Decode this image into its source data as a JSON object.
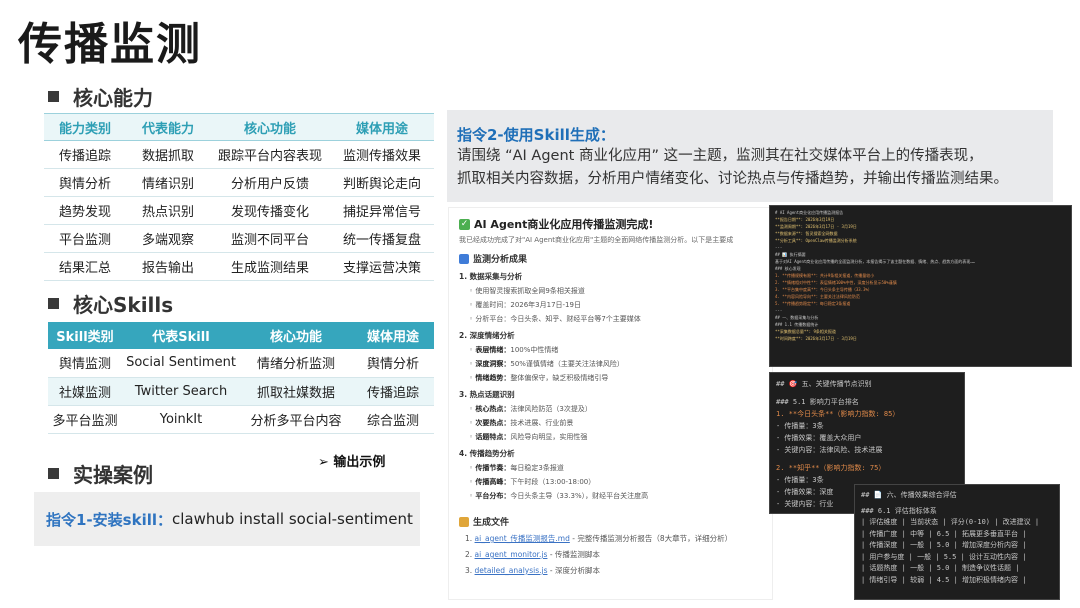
{
  "title": "传播监测",
  "section1": "核心能力",
  "section2": "核心Skills",
  "section3": "实操案例",
  "table1": {
    "headers": [
      "能力类别",
      "代表能力",
      "核心功能",
      "媒体用途"
    ],
    "rows": [
      [
        "传播追踪",
        "数据抓取",
        "跟踪平台内容表现",
        "监测传播效果"
      ],
      [
        "舆情分析",
        "情绪识别",
        "分析用户反馈",
        "判断舆论走向"
      ],
      [
        "趋势发现",
        "热点识别",
        "发现传播变化",
        "捕捉异常信号"
      ],
      [
        "平台监测",
        "多端观察",
        "监测不同平台",
        "统一传播复盘"
      ],
      [
        "结果汇总",
        "报告输出",
        "生成监测结果",
        "支撑运营决策"
      ]
    ]
  },
  "table2": {
    "headers": [
      "Skill类别",
      "代表Skill",
      "核心功能",
      "媒体用途"
    ],
    "rows": [
      [
        "舆情监测",
        "Social Sentiment",
        "情绪分析监测",
        "舆情分析"
      ],
      [
        "社媒监测",
        "Twitter Search",
        "抓取社媒数据",
        "传播追踪"
      ],
      [
        "多平台监测",
        "YoinkIt",
        "分析多平台内容",
        "综合监测"
      ]
    ]
  },
  "case1": {
    "label": "指令1-安装skill：",
    "command": "clawhub install social-sentiment"
  },
  "example_label": "➢  输出示例",
  "instruction2": {
    "heading": "指令2-使用Skill生成：",
    "line1": "请围绕 “AI Agent 商业化应用” 这一主题，监测其在社交媒体平台上的传播表现，",
    "line2": "抓取相关内容数据，分析用户情绪变化、讨论热点与传播趋势，并输出传播监测结果。"
  },
  "report": {
    "title": "AI Agent商业化应用传播监测完成!",
    "subtitle": "我已经成功完成了对\"AI Agent商业化应用\"主题的全面网络传播监测分析。以下是主要成",
    "summary_heading": "监测分析成果",
    "s1": "1. 数据采集与分析",
    "s1_items": [
      "使用智灵搜索抓取全网9条相关报道",
      "覆盖时间：2026年3月17日-19日",
      "分析平台：今日头条、知乎、财经平台等7个主要媒体"
    ],
    "s2": "2. 深度情绪分析",
    "s2_items": [
      [
        "表层情绪：",
        "100%中性情绪"
      ],
      [
        "深度洞察：",
        "50%谨慎情绪（主要关注法律风险）"
      ],
      [
        "情绪趋势：",
        "整体偏保守，缺乏积极情绪引导"
      ]
    ],
    "s3": "3. 热点话题识别",
    "s3_items": [
      [
        "核心热点：",
        "法律风险防范（3次提及）"
      ],
      [
        "次要热点：",
        "技术进展、行业前景"
      ],
      [
        "话题特点：",
        "风险导向明显，实用性强"
      ]
    ],
    "s4": "4. 传播趋势分析",
    "s4_items": [
      [
        "传播节奏：",
        "每日稳定3条报道"
      ],
      [
        "传播高峰：",
        "下午时段（13:00-18:00）"
      ],
      [
        "平台分布：",
        "今日头条主导（33.3%），财经平台关注度高"
      ]
    ],
    "files_heading": "生成文件",
    "files": [
      [
        "1.",
        "ai_agent_传播监测报告.md",
        " - 完整传播监测分析报告（8大章节，详细分析）"
      ],
      [
        "2.",
        "ai_agent_monitor.js",
        " - 传播监测脚本"
      ],
      [
        "3.",
        "detailed_analysis.js",
        " - 深度分析脚本"
      ]
    ]
  },
  "terminal2": {
    "heading": "## 🎯 五、关键传播节点识别",
    "h51": "### 5.1 影响力平台排名",
    "item1": "1. **今日头条**（影响力指数: 85）",
    "item1_lines": [
      "- 传播量：3条",
      "- 传播效果：覆盖大众用户",
      "- 关键内容：法律风险、技术进展"
    ],
    "item2": "2. **知乎**（影响力指数: 75）",
    "item2_lines": [
      "- 传播量：3条",
      "- 传播效果：深度",
      "- 关键内容：行业"
    ]
  },
  "terminal3": {
    "heading": "## 📄 六、传播效果综合评估",
    "h61": "### 6.1 评估指标体系",
    "header_row": "| 评估维度 | 当前状态 | 评分(0-10) | 改进建议 |",
    "rows": [
      "| 传播广度 | 中等 | 6.5 | 拓展更多垂直平台 |",
      "| 传播深度 | 一般 | 5.0 | 增加深度分析内容 |",
      "| 用户参与度 | 一般 | 5.5 | 设计互动性内容 |",
      "| 话题热度 | 一般 | 5.0 | 制造争议性话题 |",
      "| 情绪引导 | 较弱 | 4.5 | 增加积极情绪内容 |"
    ]
  },
  "terminal1": {
    "lines": [
      "# AI Agent商业化应用传播监测报告",
      "**报告日期**: 2026年3月19日",
      "**监测周期**: 2026年3月17日 - 3月19日",
      "**数据来源**: 智灵搜索全网数据",
      "**分析工具**: OpenClaw传播监测分析系统",
      "---",
      "## 📊 执行摘要",
      "基于对AI Agent商业化应用传播的全面监测分析，本报告揭示了该主题在数据、情绪、热点、趋势方面的表现……",
      "### 核心发现",
      "1. **传播规模有限**：共计9条相关报道，传播量较小",
      "2. **情绪相对中性**：表层情绪100%中性，深度分析显示50%谨慎",
      "3. **平台集中度高**：今日头条主导传播（33.3%）",
      "4. **内容风险导向**：主要关注法律风险防范",
      "5. **传播趋势稳定**：每日稳定3条报道",
      "---",
      "## 一、数据采集与分析",
      "### 1.1 传播数据统计",
      "**采集数据总量**: 9条相关报道",
      "**时间跨度**: 2026年3月17日 - 3月19日"
    ]
  }
}
